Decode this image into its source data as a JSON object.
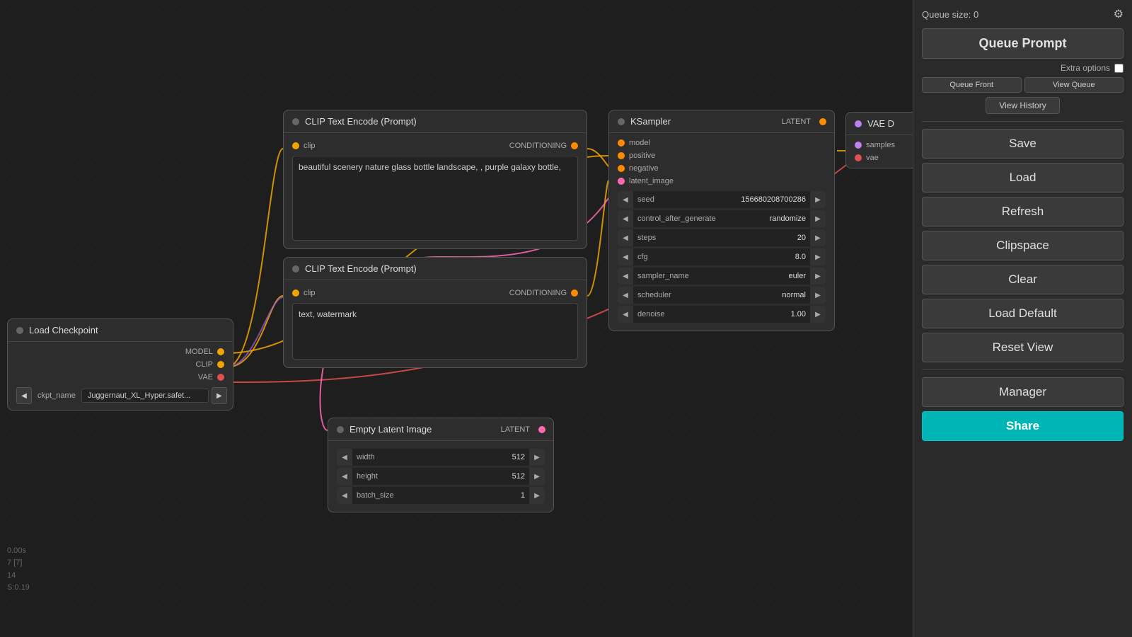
{
  "sidebar": {
    "queue_size_label": "Queue size: 0",
    "queue_prompt_label": "Queue Prompt",
    "extra_options_label": "Extra options",
    "queue_front_label": "Queue Front",
    "view_queue_label": "View Queue",
    "view_history_label": "View History",
    "save_label": "Save",
    "load_label": "Load",
    "refresh_label": "Refresh",
    "clipspace_label": "Clipspace",
    "clear_label": "Clear",
    "load_default_label": "Load Default",
    "reset_view_label": "Reset View",
    "manager_label": "Manager",
    "share_label": "Share"
  },
  "nodes": {
    "clip_positive": {
      "title": "CLIP Text Encode (Prompt)",
      "port_clip": "clip",
      "port_conditioning": "CONDITIONING",
      "text": "beautiful scenery nature glass bottle landscape, , purple galaxy bottle,"
    },
    "clip_negative": {
      "title": "CLIP Text Encode (Prompt)",
      "port_clip": "clip",
      "port_conditioning": "CONDITIONING",
      "text": "text, watermark"
    },
    "ksampler": {
      "title": "KSampler",
      "port_model": "model",
      "port_positive": "positive",
      "port_negative": "negative",
      "port_latent_image": "latent_image",
      "port_latent": "LATENT",
      "params": [
        {
          "name": "seed",
          "value": "156680208700286"
        },
        {
          "name": "control_after_generate",
          "value": "randomize"
        },
        {
          "name": "steps",
          "value": "20"
        },
        {
          "name": "cfg",
          "value": "8.0"
        },
        {
          "name": "sampler_name",
          "value": "euler"
        },
        {
          "name": "scheduler",
          "value": "normal"
        },
        {
          "name": "denoise",
          "value": "1.00"
        }
      ]
    },
    "load_checkpoint": {
      "title": "Load Checkpoint",
      "port_model": "MODEL",
      "port_clip": "CLIP",
      "port_vae": "VAE",
      "ckpt_param_name": "ckpt_name",
      "ckpt_value": "Juggernaut_XL_Hyper.safet..."
    },
    "empty_latent": {
      "title": "Empty Latent Image",
      "port_latent": "LATENT",
      "params": [
        {
          "name": "width",
          "value": "512"
        },
        {
          "name": "height",
          "value": "512"
        },
        {
          "name": "batch_size",
          "value": "1"
        }
      ]
    },
    "vae_decode": {
      "title": "VAE D",
      "port_samples": "samples",
      "port_vae": "vae"
    }
  },
  "status": {
    "line1": "0.00s",
    "line2": "7 [7]",
    "line3": "14",
    "line4": "S:0.19"
  }
}
